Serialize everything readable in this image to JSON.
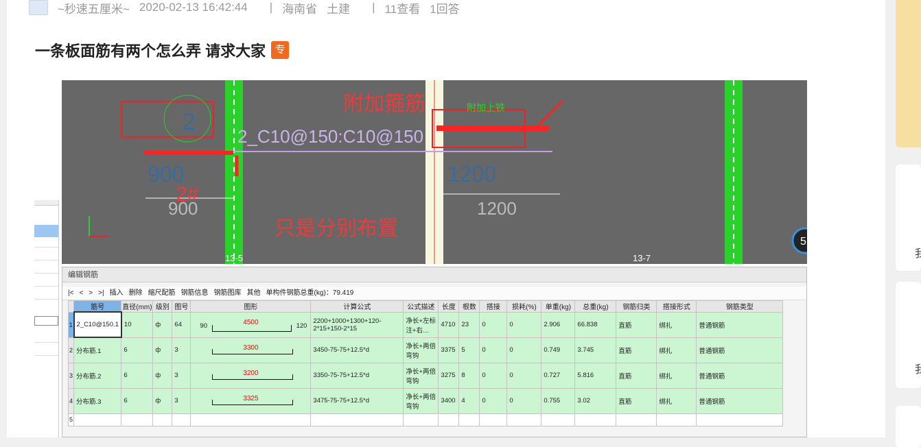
{
  "meta": {
    "user": "~秒速五厘米~",
    "datetime": "2020-02-13 16:42:44",
    "sep": "|",
    "region": "海南省",
    "field": "土建",
    "views": "11查看",
    "answers": "1回答"
  },
  "title": "一条板面筋有两个怎么弄 请求大家",
  "tag": "专",
  "cad": {
    "annotations": [
      "附加箍筋",
      "2#",
      "只是分别布置"
    ],
    "rebar_label": "2_C10@150:C10@150",
    "dim_left": "900",
    "dim_right": "1200",
    "grid_a": "13-5",
    "grid_b": "13-7",
    "circle_num": "2",
    "small_label": "附加上铁",
    "badge": "5",
    "dim_ghost_left": "900",
    "dim_ghost_right": "1200"
  },
  "window": {
    "title": "编辑钢筋",
    "nav": [
      "|<",
      "<",
      ">",
      ">|"
    ],
    "toolbar": [
      "插入",
      "删除",
      "缩尺配筋",
      "钢筋信息",
      "钢筋图库",
      "其他",
      "单构件钢筋总重(kg)：79.419"
    ]
  },
  "table": {
    "headers": [
      "筋号",
      "直径(mm)",
      "级别",
      "图号",
      "图形",
      "计算公式",
      "公式描述",
      "长度",
      "根数",
      "搭接",
      "损耗(%)",
      "单重(kg)",
      "总重(kg)",
      "钢筋归类",
      "搭接形式",
      "钢筋类型"
    ],
    "rows": [
      {
        "n": "1",
        "name": "2_C10@150.1",
        "d": "10",
        "lv": "ф",
        "fig": "64",
        "sl": "90",
        "sv": "4500",
        "sr": "120",
        "formula": "2200+1000+1300+120-2*15+150-2*15",
        "desc": "净长+左标注+右…",
        "len": "4710",
        "cnt": "23",
        "lap": "0",
        "loss": "0",
        "uw": "2.906",
        "tw": "66.838",
        "cat": "直筋",
        "lt": "绑扎",
        "type": "普通钢筋"
      },
      {
        "n": "2",
        "name": "分布筋.1",
        "d": "6",
        "lv": "ф",
        "fig": "3",
        "sl": "",
        "sv": "3300",
        "sr": "",
        "formula": "3450-75-75+12.5*d",
        "desc": "净长+两倍弯钩",
        "len": "3375",
        "cnt": "5",
        "lap": "0",
        "loss": "0",
        "uw": "0.749",
        "tw": "3.745",
        "cat": "直筋",
        "lt": "绑扎",
        "type": "普通钢筋"
      },
      {
        "n": "3",
        "name": "分布筋.2",
        "d": "6",
        "lv": "ф",
        "fig": "3",
        "sl": "",
        "sv": "3200",
        "sr": "",
        "formula": "3350-75-75+12.5*d",
        "desc": "净长+两倍弯钩",
        "len": "3275",
        "cnt": "8",
        "lap": "0",
        "loss": "0",
        "uw": "0.727",
        "tw": "5.816",
        "cat": "直筋",
        "lt": "绑扎",
        "type": "普通钢筋"
      },
      {
        "n": "4",
        "name": "分布筋.3",
        "d": "6",
        "lv": "ф",
        "fig": "3",
        "sl": "",
        "sv": "3325",
        "sr": "",
        "formula": "3475-75-75+12.5*d",
        "desc": "净长+两倍弯钩",
        "len": "3400",
        "cnt": "4",
        "lap": "0",
        "loss": "0",
        "uw": "0.755",
        "tw": "3.02",
        "cat": "直筋",
        "lt": "绑扎",
        "type": "普通钢筋"
      }
    ],
    "last_row": "5"
  },
  "right": {
    "c1": "我",
    "c2": "我"
  }
}
